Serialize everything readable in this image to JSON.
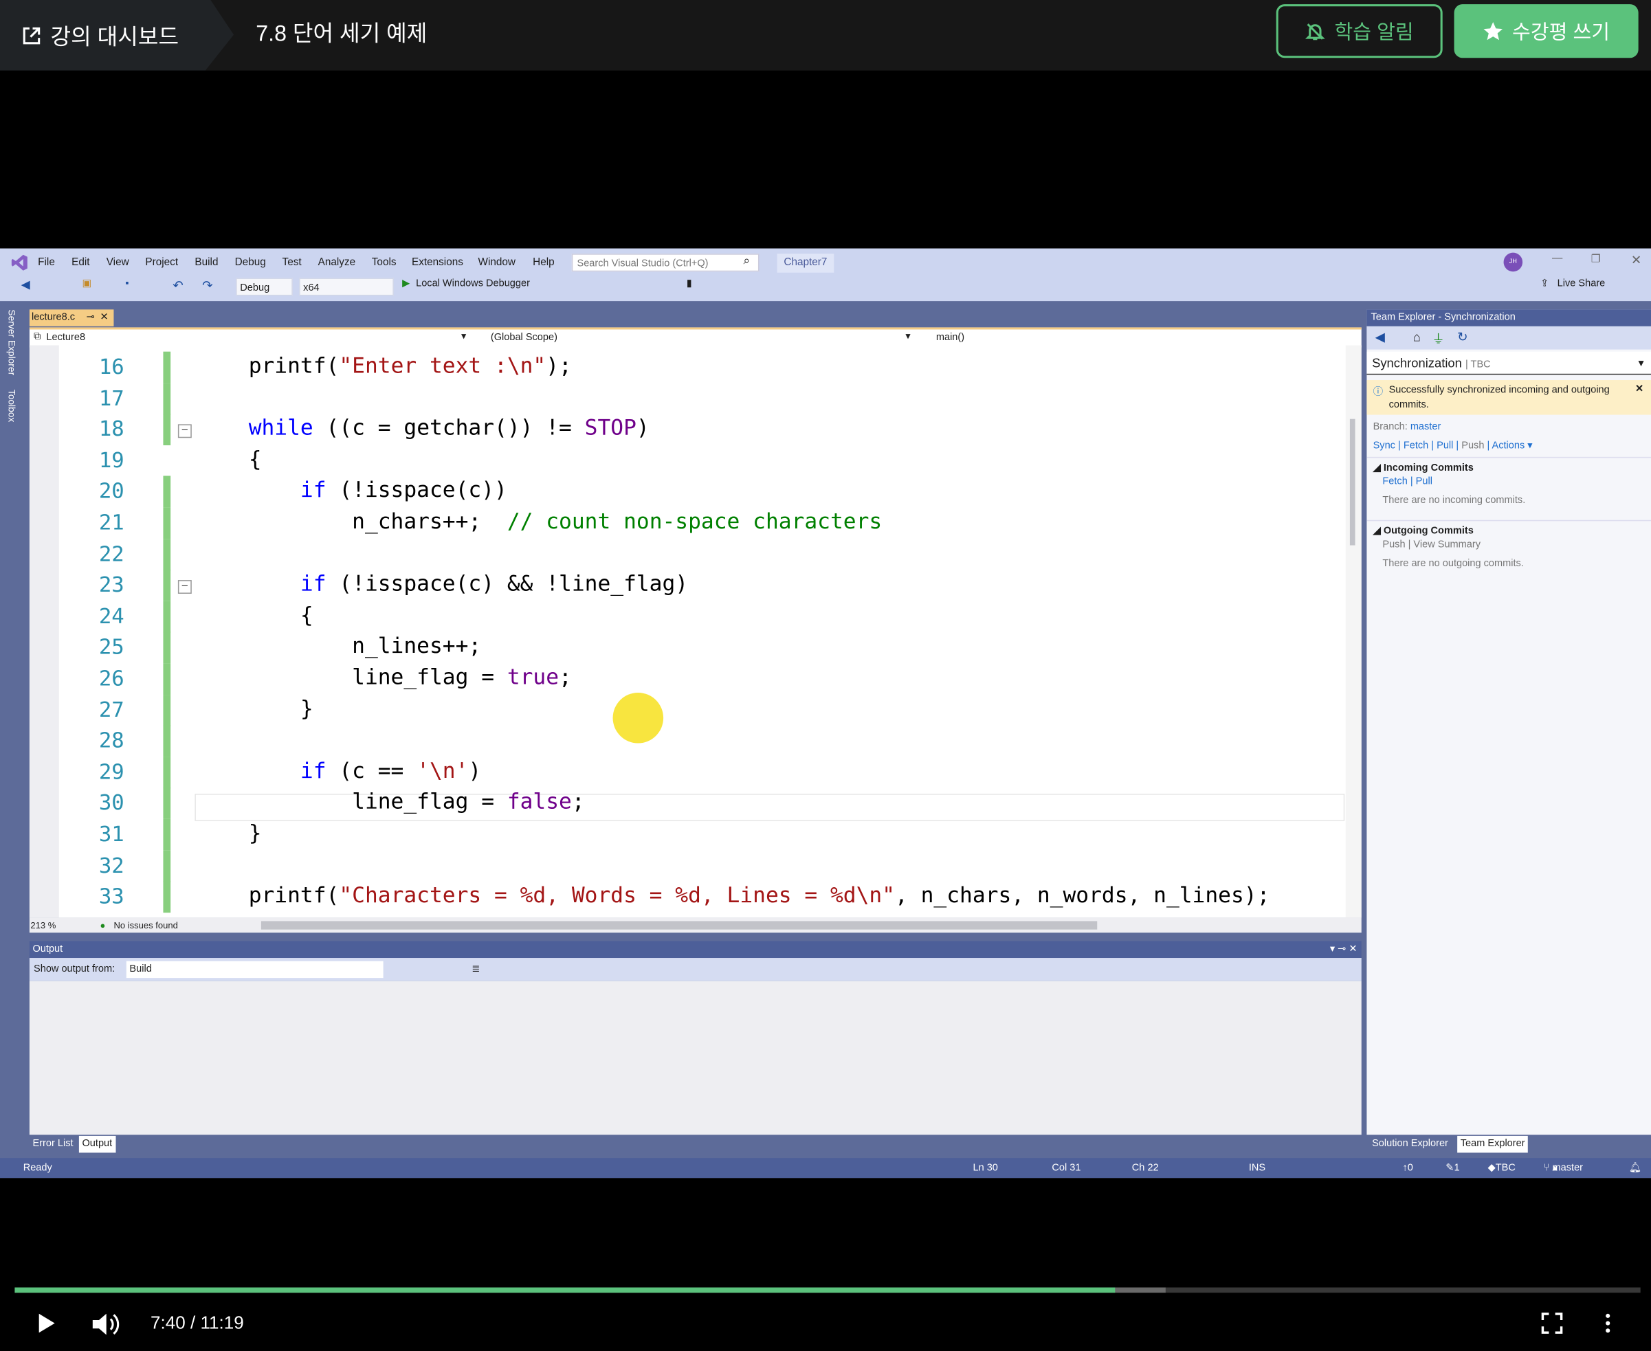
{
  "header": {
    "dashboard_label": "강의 대시보드",
    "lecture_title": "7.8 단어 세기 예제",
    "alarm_button": "학습 알림",
    "review_button": "수강평 쓰기",
    "accent": "#5bc27c"
  },
  "vs": {
    "menu": [
      "File",
      "Edit",
      "View",
      "Project",
      "Build",
      "Debug",
      "Test",
      "Analyze",
      "Tools",
      "Extensions",
      "Window",
      "Help"
    ],
    "search_placeholder": "Search Visual Studio (Ctrl+Q)",
    "solution": "Chapter7",
    "avatar": "JH",
    "config": "Debug",
    "platform": "x64",
    "debugger": "Local Windows Debugger",
    "live_share": "Live Share",
    "side_tabs": [
      "Server Explorer",
      "Toolbox"
    ],
    "doc_tab": "lecture8.c",
    "nav": {
      "project": "Lecture8",
      "scope": "(Global Scope)",
      "member": "main()"
    },
    "code": [
      {
        "n": "16",
        "chg": true,
        "t": [
          [
            "",
            "    printf("
          ],
          [
            "str",
            "\"Enter text :\\n\""
          ],
          [
            "",
            ");"
          ]
        ]
      },
      {
        "n": "17",
        "chg": true,
        "t": []
      },
      {
        "n": "18",
        "chg": true,
        "fold": true,
        "t": [
          [
            "kw",
            "    while"
          ],
          [
            "",
            " ((c = getchar()) != "
          ],
          [
            "mac",
            "STOP"
          ],
          [
            "",
            ")"
          ]
        ]
      },
      {
        "n": "19",
        "chg": false,
        "t": [
          [
            "",
            "    {"
          ]
        ]
      },
      {
        "n": "20",
        "chg": true,
        "t": [
          [
            "kw",
            "        if"
          ],
          [
            "",
            " (!isspace(c))"
          ]
        ]
      },
      {
        "n": "21",
        "chg": true,
        "t": [
          [
            "",
            "            n_chars++;  "
          ],
          [
            "cm",
            "// count non-space characters"
          ]
        ]
      },
      {
        "n": "22",
        "chg": true,
        "t": []
      },
      {
        "n": "23",
        "chg": true,
        "fold": true,
        "t": [
          [
            "kw",
            "        if"
          ],
          [
            "",
            " (!isspace(c) && !line_flag)"
          ]
        ]
      },
      {
        "n": "24",
        "chg": true,
        "t": [
          [
            "",
            "        {"
          ]
        ]
      },
      {
        "n": "25",
        "chg": true,
        "t": [
          [
            "",
            "            n_lines++;"
          ]
        ]
      },
      {
        "n": "26",
        "chg": true,
        "t": [
          [
            "",
            "            line_flag = "
          ],
          [
            "mac",
            "true"
          ],
          [
            "",
            ";"
          ]
        ]
      },
      {
        "n": "27",
        "chg": true,
        "t": [
          [
            "",
            "        }"
          ]
        ]
      },
      {
        "n": "28",
        "chg": true,
        "t": []
      },
      {
        "n": "29",
        "chg": true,
        "t": [
          [
            "kw",
            "        if"
          ],
          [
            "",
            " (c == "
          ],
          [
            "str",
            "'\\n'"
          ],
          [
            "",
            ")"
          ]
        ]
      },
      {
        "n": "30",
        "chg": true,
        "t": [
          [
            "",
            "            line_flag = "
          ],
          [
            "mac",
            "false"
          ],
          [
            "",
            ";"
          ]
        ]
      },
      {
        "n": "31",
        "chg": true,
        "t": [
          [
            "",
            "    }"
          ]
        ]
      },
      {
        "n": "32",
        "chg": true,
        "t": []
      },
      {
        "n": "33",
        "chg": true,
        "t": [
          [
            "",
            "    printf("
          ],
          [
            "str",
            "\"Characters = %d, Words = %d, Lines = %d\\n\""
          ],
          [
            "",
            ", n_chars, n_words, n_lines);"
          ]
        ]
      }
    ],
    "zoom": "213 %",
    "issues": "No issues found",
    "output": {
      "title": "Output",
      "show_from_label": "Show output from:",
      "source": "Build"
    },
    "bottom_tabs": [
      "Error List",
      "Output"
    ],
    "status": {
      "ready": "Ready",
      "ln": "Ln 30",
      "col": "Col 31",
      "ch": "Ch 22",
      "mode": "INS",
      "up": "0",
      "pending": "1",
      "repo": "TBC",
      "branch": "master"
    },
    "team": {
      "title": "Team Explorer - Synchronization",
      "page": "Synchronization",
      "repo": "TBC",
      "banner": "Successfully synchronized incoming and outgoing commits.",
      "branch_label": "Branch:",
      "branch": "master",
      "actions": [
        "Sync",
        "Fetch",
        "Pull",
        "Push",
        "Actions"
      ],
      "incoming": {
        "title": "Incoming Commits",
        "links": [
          "Fetch",
          "Pull"
        ],
        "empty": "There are no incoming commits."
      },
      "outgoing": {
        "title": "Outgoing Commits",
        "links": [
          "Push",
          "View Summary"
        ],
        "empty": "There are no outgoing commits."
      },
      "tabs": [
        "Solution Explorer",
        "Team Explorer"
      ]
    }
  },
  "player": {
    "time": "7:40 / 11:19",
    "played_fraction": 0.677,
    "buffered_fraction": 0.708
  }
}
